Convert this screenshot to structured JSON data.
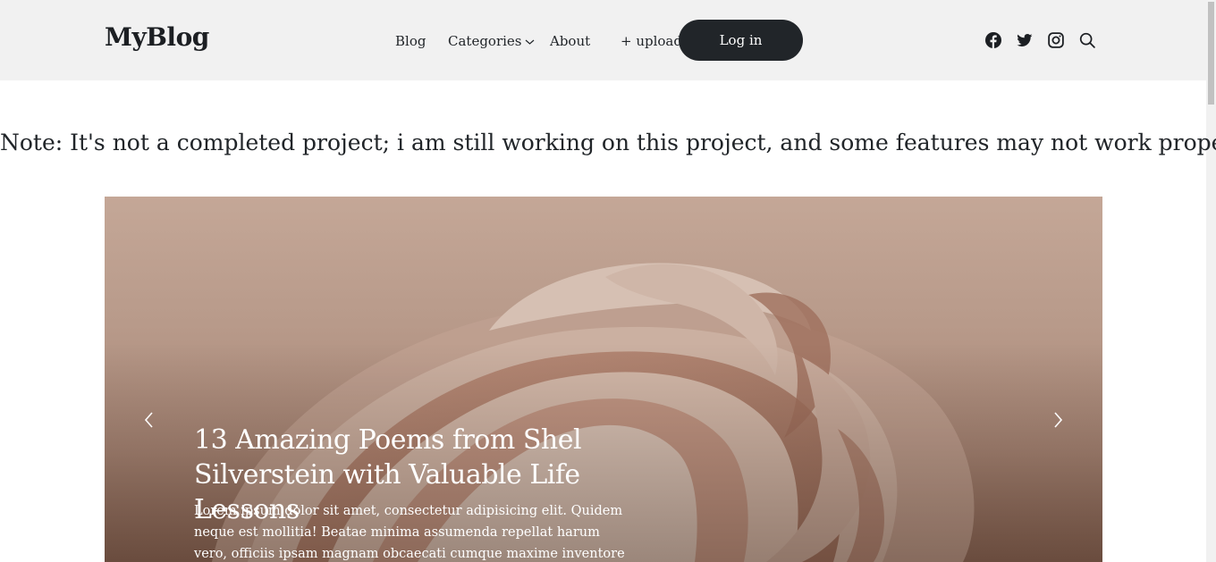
{
  "navbar": {
    "brand": "MyBlog",
    "links": {
      "blog": "Blog",
      "categories": "Categories",
      "about": "About",
      "upload": "+ upload"
    },
    "login_label": "Log in",
    "icons": [
      "facebook-icon",
      "twitter-icon",
      "instagram-icon",
      "search-icon"
    ]
  },
  "note": "Note: It's not a completed project; i am still working on this project, and some features may not work properly.",
  "hero": {
    "title": "13 Amazing Poems from Shel Silverstein with Valuable Life Lessons",
    "text": "Lorem ipsum dolor sit amet, consectetur adipisicing elit. Quidem neque est mollitia! Beatae minima assumenda repellat harum vero, officiis ipsam magnam obcaecati cumque maxime inventore repudiandae quidem necessitatibus rem"
  },
  "colors": {
    "navbar_bg": "#f1f1f1",
    "button_bg": "#212529",
    "hero_tone": "#b89a8a"
  }
}
